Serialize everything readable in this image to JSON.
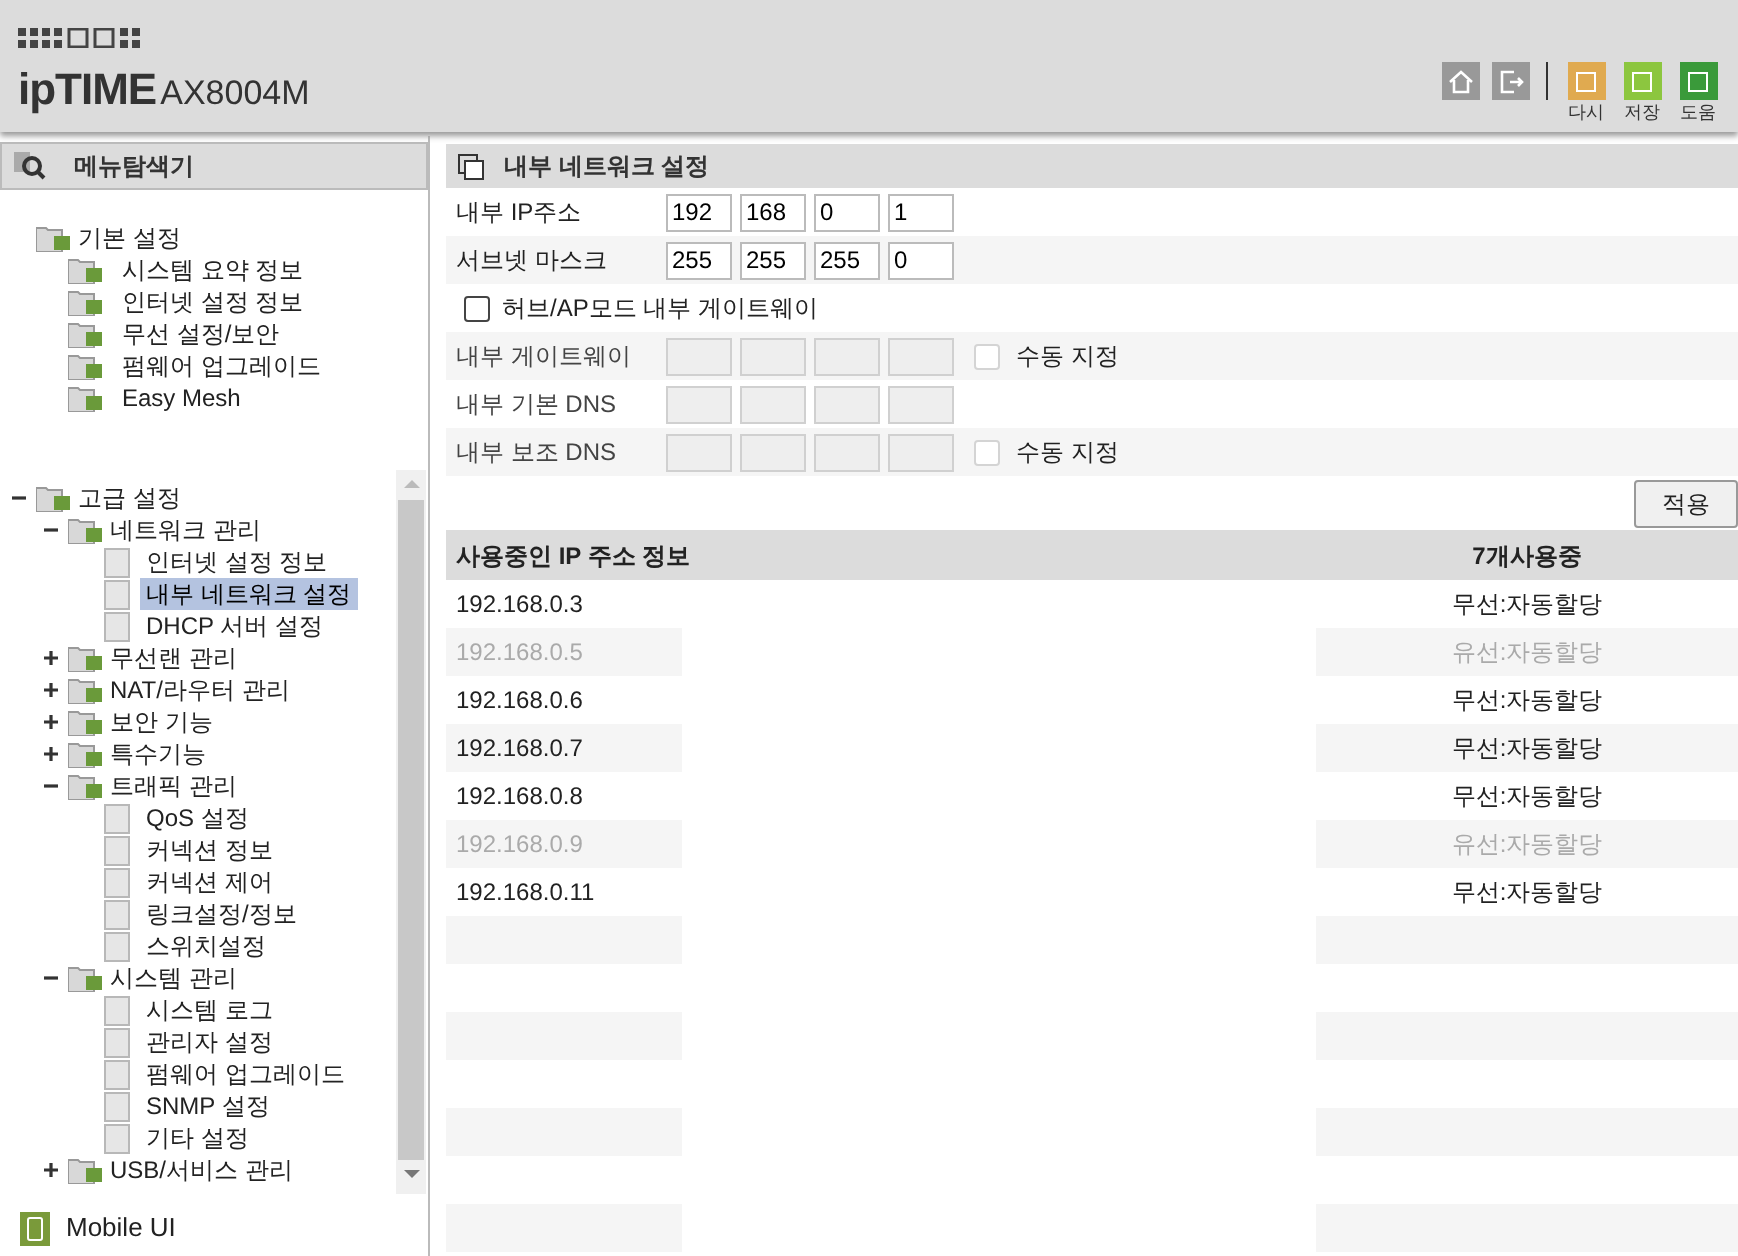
{
  "header": {
    "logo": "ipTIME",
    "model": "AX8004M",
    "actions": [
      {
        "label": "다시",
        "color": "#e0aa50"
      },
      {
        "label": "저장",
        "color": "#8cc63f"
      },
      {
        "label": "도움",
        "color": "#3a9a3a"
      }
    ]
  },
  "sidebar": {
    "title": "메뉴탐색기",
    "sections": [
      {
        "label": "기본 설정",
        "children": [
          {
            "label": "시스템 요약 정보",
            "selected": false
          },
          {
            "label": "인터넷 설정 정보",
            "selected": false
          },
          {
            "label": "무선 설정/보안",
            "selected": false
          },
          {
            "label": "펌웨어 업그레이드",
            "selected": false
          },
          {
            "label": "Easy Mesh",
            "selected": false
          }
        ]
      },
      {
        "label": "고급 설정",
        "expanded": true,
        "children": [
          {
            "label": "네트워크 관리",
            "expanded": true,
            "children": [
              {
                "label": "인터넷 설정 정보",
                "selected": false
              },
              {
                "label": "내부 네트워크 설정",
                "selected": true
              },
              {
                "label": "DHCP 서버 설정",
                "selected": false
              }
            ]
          },
          {
            "label": "무선랜 관리",
            "expanded": false
          },
          {
            "label": "NAT/라우터 관리",
            "expanded": false
          },
          {
            "label": "보안 기능",
            "expanded": false
          },
          {
            "label": "특수기능",
            "expanded": false
          },
          {
            "label": "트래픽 관리",
            "expanded": true,
            "children": [
              {
                "label": "QoS 설정",
                "selected": false
              },
              {
                "label": "커넥션 정보",
                "selected": false
              },
              {
                "label": "커넥션 제어",
                "selected": false
              },
              {
                "label": "링크설정/정보",
                "selected": false
              },
              {
                "label": "스위치설정",
                "selected": false
              }
            ]
          },
          {
            "label": "시스템 관리",
            "expanded": true,
            "children": [
              {
                "label": "시스템 로그",
                "selected": false
              },
              {
                "label": "관리자 설정",
                "selected": false
              },
              {
                "label": "펌웨어 업그레이드",
                "selected": false
              },
              {
                "label": "SNMP 설정",
                "selected": false
              },
              {
                "label": "기타 설정",
                "selected": false
              }
            ]
          },
          {
            "label": "USB/서비스 관리",
            "expanded": false
          }
        ]
      }
    ],
    "mobile": "Mobile UI"
  },
  "panel": {
    "title": "내부 네트워크 설정",
    "fields": [
      {
        "kind": "ip",
        "label": "내부 IP주소",
        "octets": [
          "192",
          "168",
          "0",
          "1"
        ],
        "disabled": false
      },
      {
        "kind": "ip",
        "label": "서브넷 마스크",
        "octets": [
          "255",
          "255",
          "255",
          "0"
        ],
        "disabled": false
      },
      {
        "kind": "checkbox",
        "label": "허브/AP모드 내부 게이트웨이",
        "checked": false
      },
      {
        "kind": "ip",
        "label": "내부 게이트웨이",
        "disabled": true,
        "manual": {
          "label": "수동 지정",
          "checked": false,
          "disabled": true
        }
      },
      {
        "kind": "ip",
        "label": "내부 기본 DNS",
        "disabled": true
      },
      {
        "kind": "ip",
        "label": "내부 보조 DNS",
        "disabled": true,
        "manual": {
          "label": "수동 지정",
          "checked": false,
          "disabled": true
        }
      }
    ],
    "apply": "적용",
    "table": {
      "title": "사용중인 IP 주소 정보",
      "count": "7개사용중",
      "rows": [
        {
          "ip": "192.168.0.3",
          "type": "무선:자동할당",
          "disabled": false
        },
        {
          "ip": "192.168.0.5",
          "type": "유선:자동할당",
          "disabled": true
        },
        {
          "ip": "192.168.0.6",
          "type": "무선:자동할당",
          "disabled": false
        },
        {
          "ip": "192.168.0.7",
          "type": "무선:자동할당",
          "disabled": false
        },
        {
          "ip": "192.168.0.8",
          "type": "무선:자동할당",
          "disabled": false
        },
        {
          "ip": "192.168.0.9",
          "type": "유선:자동할당",
          "disabled": true
        },
        {
          "ip": "192.168.0.11",
          "type": "무선:자동할당",
          "disabled": false
        }
      ]
    }
  }
}
